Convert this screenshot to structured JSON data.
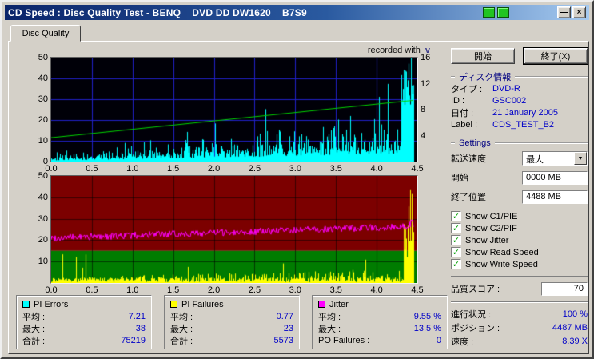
{
  "titlebar": {
    "title": "CD Speed : Disc Quality Test - BENQ    DVD DD DW1620    B7S9",
    "minimize_glyph": "—",
    "close_glyph": "×"
  },
  "tabs": {
    "disc_quality": "Disc Quality"
  },
  "watermark": {
    "text": "recorded with",
    "logo": "v"
  },
  "axes": {
    "top_left": [
      "50",
      "40",
      "30",
      "20",
      "10",
      "0"
    ],
    "top_right": [
      "16",
      "12",
      "8",
      "4"
    ],
    "bottom_left": [
      "50",
      "40",
      "30",
      "20",
      "10"
    ],
    "x_ticks": [
      "0.0",
      "0.5",
      "1.0",
      "1.5",
      "2.0",
      "2.5",
      "3.0",
      "3.5",
      "4.0",
      "4.5"
    ]
  },
  "stats": [
    {
      "title": "PI Errors",
      "rows": [
        [
          "平均 :",
          "7.21"
        ],
        [
          "最大 :",
          "38"
        ],
        [
          "合計 :",
          "75219"
        ]
      ]
    },
    {
      "title": "PI Failures",
      "rows": [
        [
          "平均 :",
          "0.77"
        ],
        [
          "最大 :",
          "23"
        ],
        [
          "合計 :",
          "5573"
        ]
      ]
    },
    {
      "title": "Jitter",
      "rows": [
        [
          "平均 :",
          "9.55 %"
        ],
        [
          "最大 :",
          "13.5 %"
        ],
        [
          "PO Failures :",
          "0"
        ]
      ]
    }
  ],
  "panel": {
    "start_button": "開始",
    "exit_button": "終了(X)",
    "disc_info": {
      "title": "ディスク情報",
      "rows": [
        [
          "タイプ :",
          "DVD-R"
        ],
        [
          "ID :",
          "GSC002"
        ],
        [
          "日付 :",
          "21 January 2005"
        ],
        [
          "Label :",
          "CDS_TEST_B2"
        ]
      ]
    },
    "settings": {
      "title": "Settings",
      "speed_label": "転送速度",
      "speed_value": "最大",
      "start_label": "開始",
      "start_value": "0000 MB",
      "end_label": "終了位置",
      "end_value": "4488 MB",
      "checkboxes": [
        "Show C1/PIE",
        "Show C2/PIF",
        "Show Jitter",
        "Show Read Speed",
        "Show Write Speed"
      ],
      "check_glyph": "✓"
    },
    "score_label": "品質スコア :",
    "score_value": "70",
    "progress_label": "進行状況 :",
    "progress_value": "100 %",
    "position_label": "ポジション :",
    "position_value": "4487 MB",
    "speed_label": "速度 :",
    "speed_value": "8.39 X"
  },
  "colors": {
    "value_blue": "#0000c8",
    "header_navy": "#000080",
    "check_green": "#00a000",
    "pie": "#00ffff",
    "pif": "#ffff00",
    "jitter": "#ff00ff",
    "write_speed": "#00d800"
  },
  "chart_data": [
    {
      "type": "area",
      "title": "PI Errors (C1/PIE) and Write Speed vs disc position (GB)",
      "x_range": [
        0,
        4.5
      ],
      "x_ticks": [
        0.0,
        0.5,
        1.0,
        1.5,
        2.0,
        2.5,
        3.0,
        3.5,
        4.0,
        4.5
      ],
      "y_left_range": [
        0,
        50
      ],
      "y_right_range": [
        0,
        16
      ],
      "grid": true,
      "plot_bg": "#000008",
      "series": [
        {
          "name": "PI Errors",
          "color": "#00ffff",
          "axis": "left",
          "average": 7.21,
          "maximum": 38,
          "total": 75219,
          "shape": "noisy spikes rising from ~3 at 0 GB to ~25 at 4.2 GB, burst to 50 at 4.3–4.45 GB, data ends ~4.46 GB"
        },
        {
          "name": "Write Speed",
          "color": "#00d800",
          "axis": "right",
          "start_value_x": 4.0,
          "end_value_x": 12.0,
          "average_x": 8.39,
          "shape": "linear ramp (CAV), left-scale 11.5 to 29.5"
        }
      ]
    },
    {
      "type": "area",
      "title": "PI Failures (C2/PIF) and Jitter vs disc position (GB)",
      "x_range": [
        0,
        4.5
      ],
      "x_ticks": [
        0.0,
        0.5,
        1.0,
        1.5,
        2.0,
        2.5,
        3.0,
        3.5,
        4.0,
        4.5
      ],
      "y_range": [
        0,
        50
      ],
      "grid": true,
      "bands": [
        {
          "range": [
            0,
            15
          ],
          "color": "#007c00"
        },
        {
          "range": [
            15,
            50
          ],
          "color": "#7c0000"
        }
      ],
      "series": [
        {
          "name": "PI Failures",
          "color": "#ffff00",
          "average": 0.77,
          "maximum": 23,
          "total": 5573,
          "shape": "small spikes 0–6 growing with position, tall burst to ~45 at 4.35–4.46 GB"
        },
        {
          "name": "Jitter",
          "color": "#ff00ff",
          "average_pct": 9.55,
          "maximum_pct": 13.5,
          "shape": "noisy band rising from ~21 to ~26.5 on 0–50 scale, spike to ~33 at end"
        }
      ]
    }
  ],
  "chart_render": {
    "end_frac": 0.992,
    "top": {
      "bg": "#000008",
      "grid": "#2121c8",
      "seed": 42,
      "pie_color": "#00ffff",
      "speed_color": "#00d800",
      "speed_start": 11.5,
      "speed_end": 29.5
    },
    "bottom": {
      "band_top_color": "#7c0000",
      "band_bottom_color": "#007c00",
      "band_split": 15,
      "grid": "rgba(0,0,0,0.55)",
      "seed_pif": 77,
      "seed_jitter": 99,
      "pif_color": "#ffff00",
      "jitter_color": "#ff00ff",
      "jitter_start": 21,
      "jitter_end": 26.5
    }
  }
}
